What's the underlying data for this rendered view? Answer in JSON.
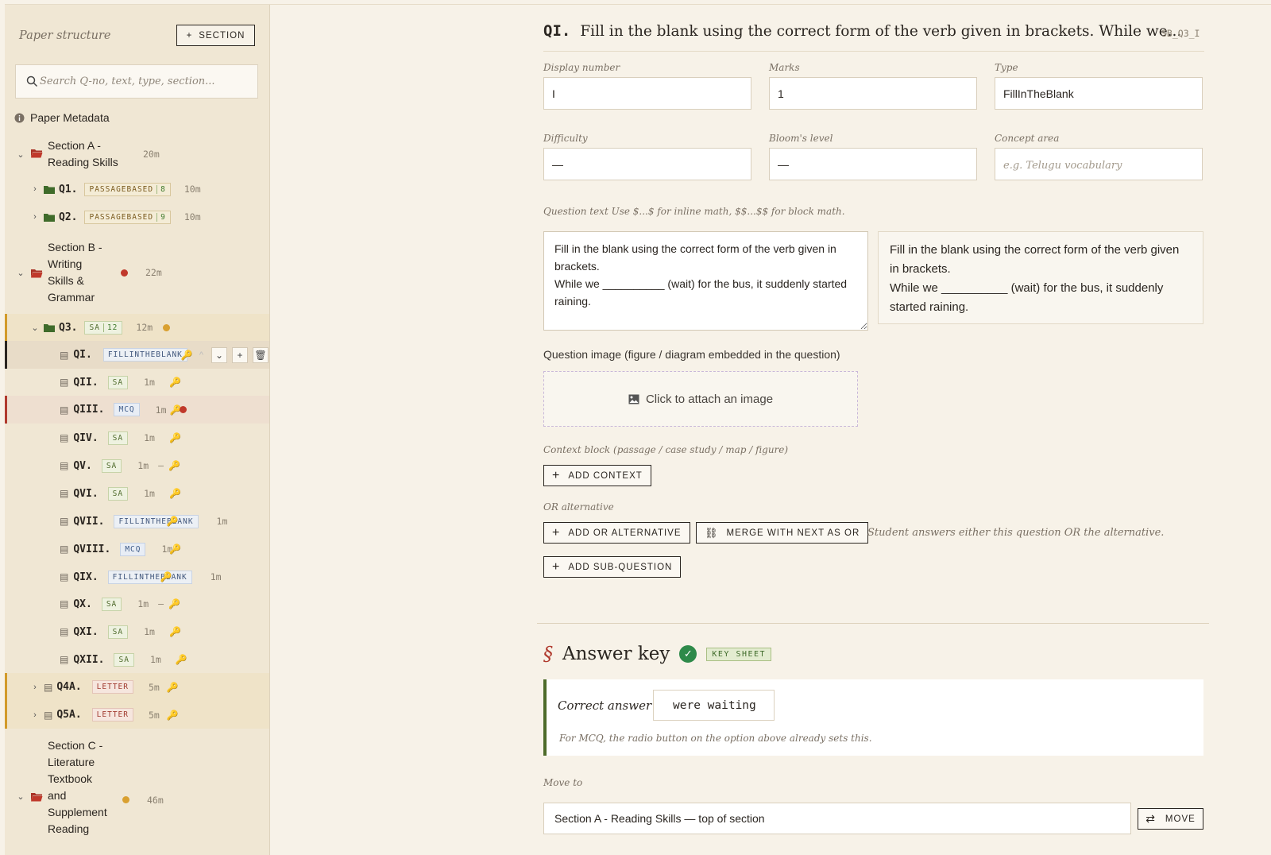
{
  "sidebar": {
    "title": "Paper structure",
    "add_section_label": "SECTION",
    "search_placeholder": "Search Q-no, text, type, section...",
    "metadata_label": "Paper Metadata",
    "section_a": {
      "title_line1": "Section A -",
      "title_line2": "Reading Skills",
      "minutes": "20m"
    },
    "q1": {
      "label": "Q1.",
      "type": "PASSAGEBASED",
      "count": "8",
      "minutes": "10m"
    },
    "q2": {
      "label": "Q2.",
      "type": "PASSAGEBASED",
      "count": "9",
      "minutes": "10m"
    },
    "section_b": {
      "line1": "Section B -",
      "line2": "Writing",
      "line3": "Skills &",
      "line4": "Grammar",
      "minutes": "22m"
    },
    "q3": {
      "label": "Q3.",
      "type": "SA",
      "count": "12",
      "minutes": "12m"
    },
    "subquestions": [
      {
        "label": "QI.",
        "type": "FILLINTHEBLANK",
        "minutes": ""
      },
      {
        "label": "QII.",
        "type": "SA",
        "minutes": "1m"
      },
      {
        "label": "QIII.",
        "type": "MCQ",
        "minutes": "1m"
      },
      {
        "label": "QIV.",
        "type": "SA",
        "minutes": "1m"
      },
      {
        "label": "QV.",
        "type": "SA",
        "minutes": "1m"
      },
      {
        "label": "QVI.",
        "type": "SA",
        "minutes": "1m"
      },
      {
        "label": "QVII.",
        "type": "FILLINTHEBLANK",
        "minutes": "1m"
      },
      {
        "label": "QVIII.",
        "type": "MCQ",
        "minutes": "1m"
      },
      {
        "label": "QIX.",
        "type": "FILLINTHEBLANK",
        "minutes": "1m"
      },
      {
        "label": "QX.",
        "type": "SA",
        "minutes": "1m"
      },
      {
        "label": "QXI.",
        "type": "SA",
        "minutes": "1m"
      },
      {
        "label": "QXII.",
        "type": "SA",
        "minutes": "1m"
      }
    ],
    "dash": "–",
    "q4a": {
      "label": "Q4A.",
      "type": "LETTER",
      "minutes": "5m"
    },
    "q5a": {
      "label": "Q5A.",
      "type": "LETTER",
      "minutes": "5m"
    },
    "section_c": {
      "line1": "Section C -",
      "line2": "Literature",
      "line3": "Textbook",
      "line4": "and",
      "line5": "Supplement",
      "line6": "Reading",
      "minutes": "46m"
    }
  },
  "question": {
    "number": "QI.",
    "title": "Fill in the blank using the correct form of the verb given in brackets. While we...",
    "id": "SB_Q3_I",
    "display_number_label": "Display number",
    "display_number": "I",
    "marks_label": "Marks",
    "marks": "1",
    "type_label": "Type",
    "type": "FillInTheBlank",
    "difficulty_label": "Difficulty",
    "difficulty": "—",
    "bloom_label": "Bloom's level",
    "bloom": "—",
    "concept_label": "Concept area",
    "concept_placeholder": "e.g. Telugu vocabulary",
    "text_label": "Question text Use $...$ for inline math, $$...$$ for block math.",
    "text": "Fill in the blank using the correct form of the verb given in brackets.\nWhile we __________ (wait) for the bus, it suddenly started raining.",
    "preview_line1": "Fill in the blank using the correct form of the verb given in brackets.",
    "preview_line2": "While we __________ (wait) for the bus, it suddenly started raining.",
    "image_label": "Question image (figure / diagram embedded in the question)",
    "image_cta": "Click to attach an image",
    "context_label": "Context block (passage / case study / map / figure)",
    "add_context": "ADD CONTEXT",
    "or_label": "OR alternative",
    "add_or": "ADD OR ALTERNATIVE",
    "merge_or": "MERGE WITH NEXT AS OR",
    "or_hint": "Student answers either this question OR the alternative.",
    "add_sub": "ADD SUB-QUESTION"
  },
  "answer_key": {
    "section_mark": "§",
    "title": "Answer key",
    "badge": "KEY SHEET",
    "correct_label": "Correct answer",
    "correct_value": "were waiting",
    "note": "For MCQ, the radio button on the option above already sets this."
  },
  "move": {
    "label": "Move to",
    "value": "Section A - Reading Skills — top of section",
    "button": "MOVE"
  },
  "colors": {
    "accent_red": "#b03a2e",
    "accent_green": "#2e8a4a",
    "folder_green": "#3f6b2a",
    "amber": "#d29a2a"
  }
}
